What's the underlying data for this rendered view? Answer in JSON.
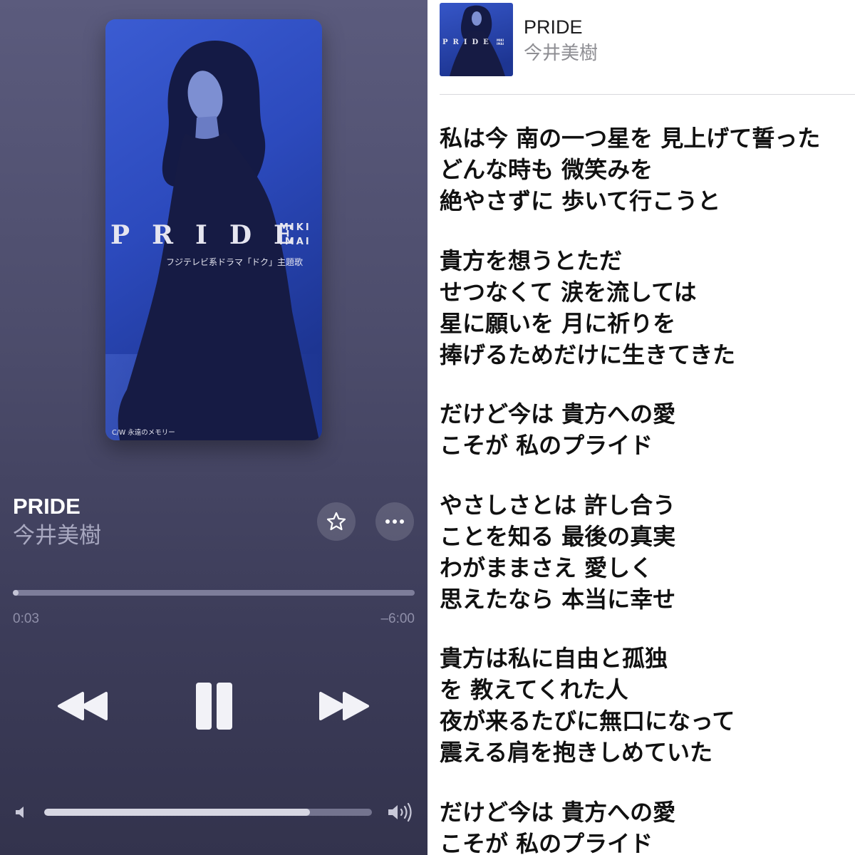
{
  "player": {
    "title": "PRIDE",
    "artist": "今井美樹",
    "elapsed": "0:03",
    "remaining": "–6:00",
    "progress": 0.008,
    "volume": 0.81
  },
  "album_art": {
    "title": "PRIDE",
    "artist_line1": "MIKI",
    "artist_line2": "IMAI",
    "tagline": "フジテレビ系ドラマ「ドク」主題歌",
    "coupling": "C/W 永遠のメモリー"
  },
  "icons": {
    "favorite": "star-icon",
    "more": "more-icon",
    "previous": "rewind-icon",
    "play_pause": "pause-icon",
    "next": "forward-icon",
    "volume_min": "volume-low-icon",
    "volume_max": "volume-high-icon"
  },
  "colors": {
    "player_bg_top": "#5b5b7d",
    "player_bg_bottom": "#33334d",
    "player_text": "#ffffff",
    "player_secondary_text": "#a8a8c0",
    "art_blue": "#2c4abd",
    "lyrics_bg": "#ffffff",
    "lyrics_text": "#111111"
  },
  "lyrics_view": {
    "title": "PRIDE",
    "artist": "今井美樹",
    "stanzas": [
      [
        "私は今 南の一つ星を 見上げて誓った",
        "どんな時も 微笑みを",
        "絶やさずに 歩いて行こうと"
      ],
      [
        "貴方を想うとただ",
        "せつなくて 涙を流しては",
        "星に願いを 月に祈りを",
        "捧げるためだけに生きてきた"
      ],
      [
        "だけど今は 貴方への愛",
        "こそが 私のプライド"
      ],
      [
        "やさしさとは 許し合う",
        "ことを知る 最後の真実",
        "わがままさえ 愛しく",
        "思えたなら 本当に幸せ"
      ],
      [
        "貴方は私に自由と孤独",
        "を 教えてくれた人",
        "夜が来るたびに無口になって",
        "震える肩を抱きしめていた"
      ],
      [
        "だけど今は 貴方への愛",
        "こそが 私のプライド"
      ]
    ]
  }
}
